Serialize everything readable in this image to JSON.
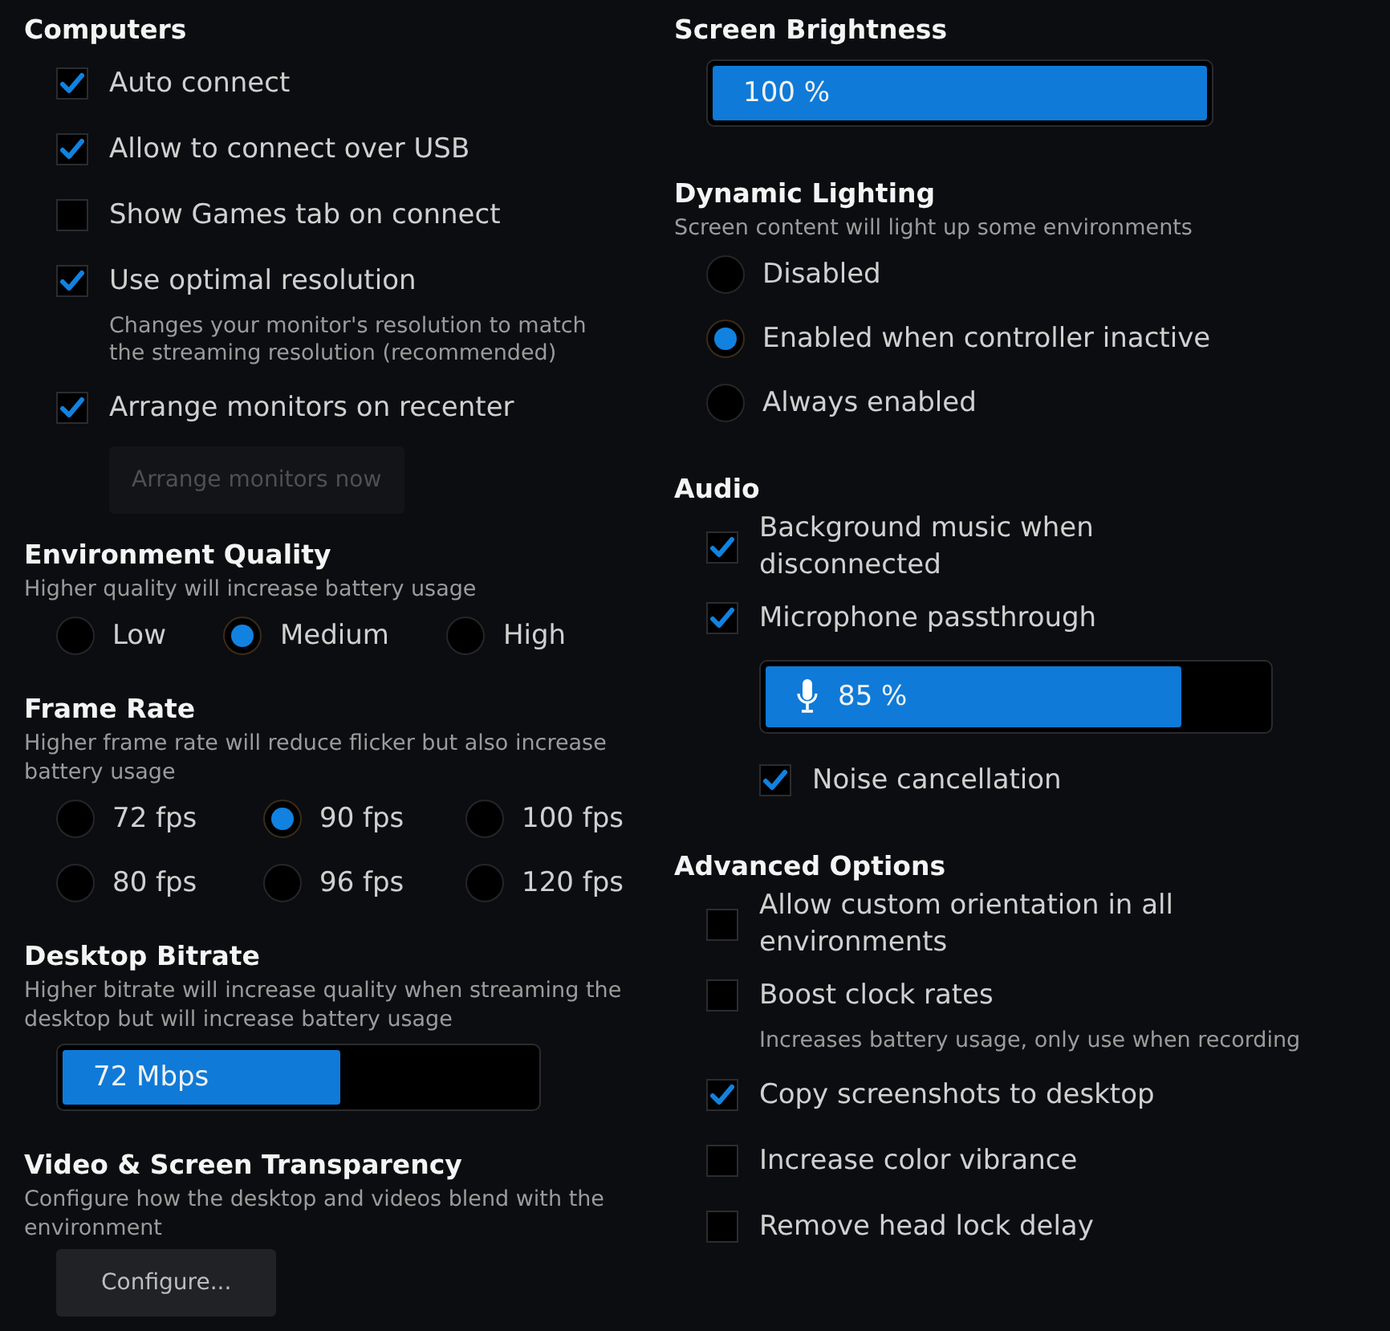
{
  "columns": [
    {
      "sections": [
        {
          "title": "Computers",
          "items": [
            {
              "kind": "checkbox",
              "label": "Auto connect",
              "checked": true
            },
            {
              "kind": "checkbox",
              "label": "Allow to connect over USB",
              "checked": true
            },
            {
              "kind": "checkbox",
              "label": "Show Games tab on connect",
              "checked": false
            },
            {
              "kind": "checkbox",
              "label": "Use optimal resolution",
              "checked": true,
              "note": "Changes your monitor's resolution to match the streaming resolution (recommended)"
            },
            {
              "kind": "checkbox",
              "label": "Arrange monitors on recenter",
              "checked": true,
              "children": [
                {
                  "kind": "button",
                  "label": "Arrange monitors now",
                  "disabled": true
                }
              ]
            }
          ]
        },
        {
          "title": "Environment Quality",
          "description": "Higher quality will increase battery usage",
          "items": [
            {
              "kind": "radio_row",
              "options": [
                {
                  "label": "Low",
                  "selected": false
                },
                {
                  "label": "Medium",
                  "selected": true
                },
                {
                  "label": "High",
                  "selected": false
                }
              ]
            }
          ]
        },
        {
          "title": "Frame Rate",
          "description": "Higher frame rate will reduce flicker but also increase battery usage",
          "items": [
            {
              "kind": "radio_grid",
              "options": [
                {
                  "label": "72 fps",
                  "selected": false
                },
                {
                  "label": "90 fps",
                  "selected": true
                },
                {
                  "label": "100 fps",
                  "selected": false
                },
                {
                  "label": "80 fps",
                  "selected": false
                },
                {
                  "label": "96 fps",
                  "selected": false
                },
                {
                  "label": "120 fps",
                  "selected": false
                }
              ]
            }
          ]
        },
        {
          "title": "Desktop Bitrate",
          "description": "Higher bitrate will increase quality when streaming the desktop but will increase battery usage",
          "items": [
            {
              "kind": "slider",
              "value": "72 Mbps",
              "level": 0.59
            }
          ]
        },
        {
          "title": "Video & Screen Transparency",
          "description": "Configure how the desktop and videos blend with the environment",
          "items": [
            {
              "kind": "button",
              "label": "Configure...",
              "disabled": false
            }
          ]
        }
      ]
    },
    {
      "sections": [
        {
          "title": "Screen Brightness",
          "items": [
            {
              "kind": "slider",
              "value": "100 %",
              "level": 1
            }
          ]
        },
        {
          "title": "Dynamic Lighting",
          "description": "Screen content will light up some environments",
          "items": [
            {
              "kind": "radio_list",
              "options": [
                {
                  "label": "Disabled",
                  "selected": false
                },
                {
                  "label": "Enabled when controller inactive",
                  "selected": true
                },
                {
                  "label": "Always enabled",
                  "selected": false
                }
              ]
            }
          ]
        },
        {
          "title": "Audio",
          "items": [
            {
              "kind": "checkbox",
              "label": "Background music when disconnected",
              "checked": true
            },
            {
              "kind": "checkbox",
              "label": "Microphone passthrough",
              "checked": true,
              "children": [
                {
                  "kind": "mic_slider",
                  "value": "85 %",
                  "level": 0.83
                },
                {
                  "kind": "checkbox",
                  "label": "Noise cancellation",
                  "checked": true
                }
              ]
            }
          ]
        },
        {
          "title": "Advanced Options",
          "items": [
            {
              "kind": "checkbox",
              "label": "Allow custom orientation in all environments",
              "checked": false
            },
            {
              "kind": "checkbox",
              "label": "Boost clock rates",
              "checked": false,
              "note": "Increases battery usage, only use when recording"
            },
            {
              "kind": "checkbox",
              "label": "Copy screenshots to desktop",
              "checked": true
            },
            {
              "kind": "checkbox",
              "label": "Increase color vibrance",
              "checked": false
            },
            {
              "kind": "checkbox",
              "label": "Remove head lock delay",
              "checked": false
            }
          ]
        }
      ]
    }
  ]
}
